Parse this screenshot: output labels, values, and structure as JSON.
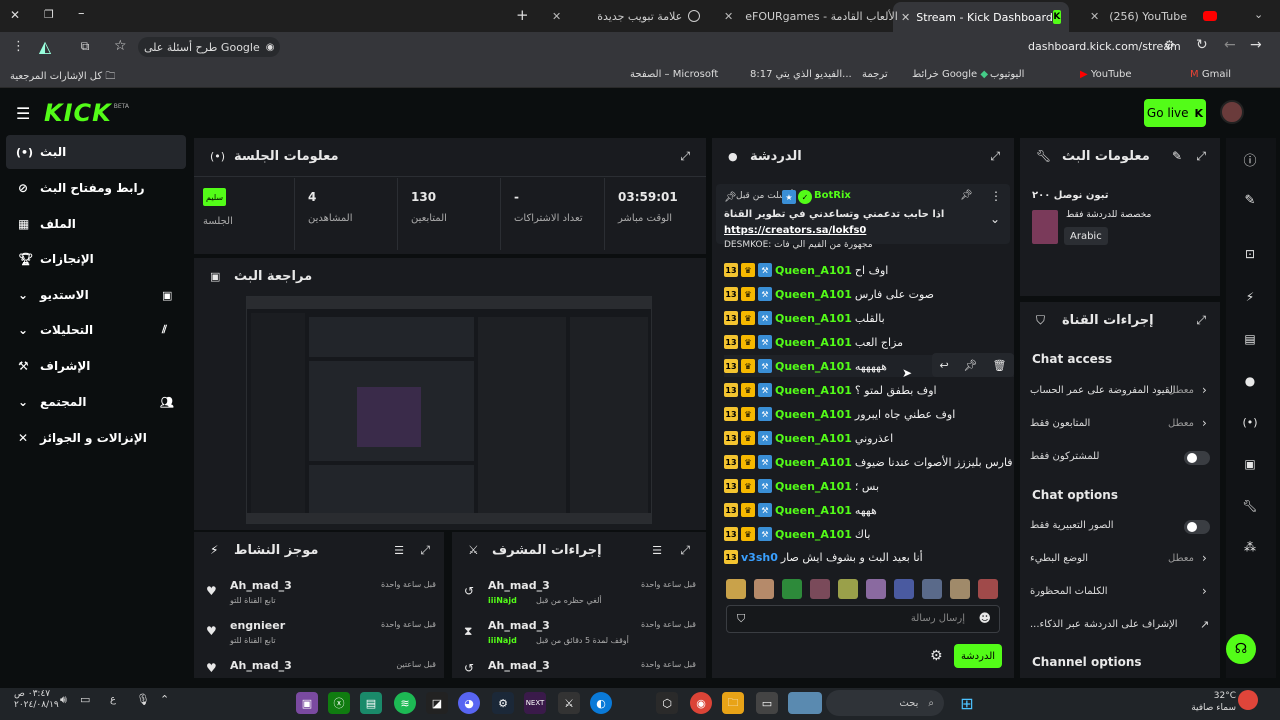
{
  "browser": {
    "tabs": [
      {
        "label": "(256) YouTube"
      },
      {
        "label": "Stream - Kick Dashboard"
      },
      {
        "label": "eFOURgames - الألعاب القادمة"
      },
      {
        "label": "علامة تبويب جديدة"
      }
    ],
    "url": "dashboard.kick.com/stream",
    "search_prompt": "طرح أسئلة على Google",
    "bookmarks": [
      "Gmail",
      "YouTube",
      "اليوتيوب",
      "خرائط Google",
      "ترجمة",
      "8:17 الفيديو الذي يتي...",
      "الصفحة – Microsoft"
    ],
    "all_bookmarks": "كل الإشارات المرجعية"
  },
  "kick": {
    "logo": "KICK",
    "logo_beta": "BETA",
    "go_live": "Go live",
    "sidebar": [
      {
        "label": "البث",
        "icon": "broadcast-icon"
      },
      {
        "label": "رابط ومفتاح البث",
        "icon": "link-icon"
      },
      {
        "label": "الملف",
        "icon": "profile-icon"
      },
      {
        "label": "الإنجازات",
        "icon": "trophy-icon"
      },
      {
        "label": "الاستديو",
        "icon": "studio-icon"
      },
      {
        "label": "التحليلات",
        "icon": "analytics-icon"
      },
      {
        "label": "الإشراف",
        "icon": "moderation-icon"
      },
      {
        "label": "المجتمع",
        "icon": "community-icon"
      },
      {
        "label": "الإنزالات و الجوائز",
        "icon": "drops-icon"
      }
    ],
    "session": {
      "title": "معلومات الجلسة",
      "status_badge": "سليم",
      "session_label": "الجلسة",
      "stats": [
        {
          "value": "4",
          "label": "المشاهدين"
        },
        {
          "value": "130",
          "label": "المتابعين"
        },
        {
          "value": "-",
          "label": "تعداد الاشتراكات"
        },
        {
          "value": "03:59:01",
          "label": "الوقت مباشر"
        }
      ]
    },
    "preview": {
      "title": "مراجعة البث"
    },
    "activity": {
      "title": "موجز النشاط",
      "items": [
        {
          "user": "Ah_mad_3",
          "text": "تابع القناة للتو",
          "time": "قبل ساعة واحدة"
        },
        {
          "user": "engnieer",
          "text": "تابع القناة للتو",
          "time": "قبل ساعة واحدة"
        },
        {
          "user": "Ah_mad_3",
          "text": "",
          "time": "قبل ساعتين"
        }
      ]
    },
    "modactions": {
      "title": "إجراءات المشرف",
      "items": [
        {
          "user": "Ah_mad_3",
          "mod": "iiiNajd",
          "text": "ألغي حظره من قبل",
          "time": "قبل ساعة واحدة"
        },
        {
          "user": "Ah_mad_3",
          "mod": "iiiNajd",
          "text": "أوقف لمدة 5 دقائق من قبل",
          "time": "قبل ساعة واحدة"
        },
        {
          "user": "Ah_mad_3",
          "mod": "",
          "text": "",
          "time": "قبل ساعة واحدة"
        }
      ]
    },
    "chat": {
      "title": "الدردشة",
      "pinned_by": "أرسلت من قبل",
      "pinned_user": "BotRix",
      "pinned_text": "اذا حابب تدعمني وتساعدني في تطوير القناة",
      "pinned_link": "https://creators.sa/lokfs0",
      "partial_line": "DESMKOE: مجهورة من الفيم الي فات",
      "messages": [
        {
          "user": "Queen_A101",
          "text": "اوف اح"
        },
        {
          "user": "Queen_A101",
          "text": "صوت على فارس"
        },
        {
          "user": "Queen_A101",
          "text": "بالقلب"
        },
        {
          "user": "Queen_A101",
          "text": "مزاج العب"
        },
        {
          "user": "Queen_A101",
          "text": "هههههه"
        },
        {
          "user": "Queen_A101",
          "text": "اوف بطفق لمتو ؟"
        },
        {
          "user": "Queen_A101",
          "text": "اوف عطني جاه ايبرور"
        },
        {
          "user": "Queen_A101",
          "text": "اعذروني"
        },
        {
          "user": "Queen_A101",
          "text": "فارس بليززز الأصوات عندنا ضيوف"
        },
        {
          "user": "Queen_A101",
          "text": "بس ؛"
        },
        {
          "user": "Queen_A101",
          "text": "هههه"
        },
        {
          "user": "Queen_A101",
          "text": "باك"
        },
        {
          "user": "v3sh0",
          "text": "أنا بعيد البث و بشوف ايش صار"
        }
      ],
      "input_placeholder": "إرسال رسالة",
      "send_label": "الدردشة"
    },
    "streaminfo": {
      "title": "معلومات البث",
      "stream_title": "تبون نوصل ٢٠٠",
      "category": "مخصصة للدردشة فقط",
      "language": "Arabic"
    },
    "channel_actions": {
      "title": "إجراءات القناة",
      "chat_access": "Chat access",
      "chat_options": "Chat options",
      "channel_options": "Channel options",
      "disabled": "معطل",
      "rows": [
        {
          "label": "القيود المفروضة على عمر الحساب"
        },
        {
          "label": "المتابعون فقط"
        },
        {
          "label": "للمشتركون فقط"
        },
        {
          "label": "الصور التعبيرية فقط"
        },
        {
          "label": "الوضع البطيء"
        },
        {
          "label": "الكلمات المحظورة"
        },
        {
          "label": "...الإشراف على الدردشة عبر الذكاء"
        }
      ]
    }
  },
  "taskbar": {
    "search": "بحث",
    "time": "٠٣:٤٧ ص",
    "date": "٢٠٢٤/٠٨/١٩",
    "weather": "32°C",
    "weather_text": "سماء صافية",
    "lang": "ع"
  }
}
